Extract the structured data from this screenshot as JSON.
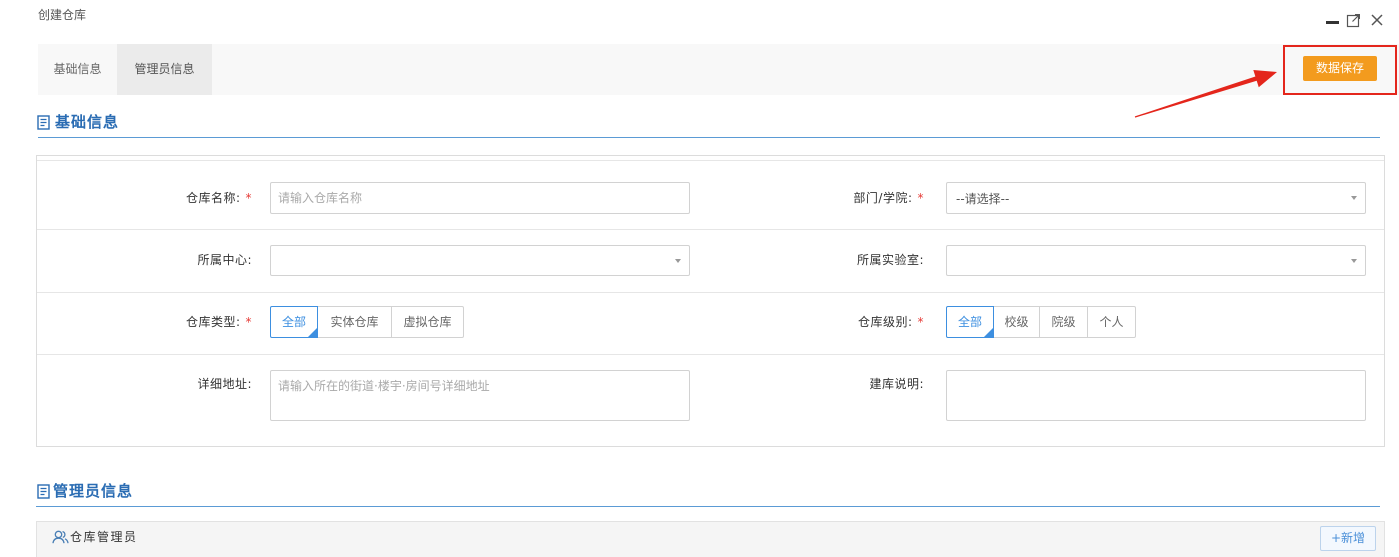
{
  "window": {
    "title": "创建仓库",
    "controls": {
      "minimize": "minimize-icon",
      "maximize": "maximize-icon",
      "close": "close-icon"
    }
  },
  "tabs": [
    {
      "label": "基础信息",
      "active": false
    },
    {
      "label": "管理员信息",
      "active": true
    }
  ],
  "toolbar": {
    "save_label": "数据保存"
  },
  "sections": {
    "basic": {
      "title": "基础信息",
      "icon": "document-icon"
    },
    "admin": {
      "title": "管理员信息",
      "icon": "document-icon"
    }
  },
  "form": {
    "required_mark": "*",
    "select_icon": "caret-down-icon",
    "warehouse_name": {
      "label": "仓库名称:",
      "placeholder": "请输入仓库名称"
    },
    "department": {
      "label": "部门/学院:",
      "selected": "--请选择--"
    },
    "center": {
      "label": "所属中心:",
      "selected": ""
    },
    "lab": {
      "label": "所属实验室:",
      "selected": ""
    },
    "warehouse_type": {
      "label": "仓库类型:",
      "options": [
        {
          "label": "全部",
          "selected": true
        },
        {
          "label": "实体仓库",
          "selected": false
        },
        {
          "label": "虚拟仓库",
          "selected": false
        }
      ]
    },
    "warehouse_level": {
      "label": "仓库级别:",
      "options": [
        {
          "label": "全部",
          "selected": true
        },
        {
          "label": "校级",
          "selected": false
        },
        {
          "label": "院级",
          "selected": false
        },
        {
          "label": "个人",
          "selected": false
        }
      ]
    },
    "address": {
      "label": "详细地址:",
      "placeholder": "请输入所在的街道·楼宇·房间号详细地址"
    },
    "description": {
      "label": "建库说明:"
    }
  },
  "admin_panel": {
    "title": "仓库管理员",
    "icon": "users-icon",
    "add_label": "+新增"
  },
  "colors": {
    "accent": "#2a6cb3",
    "accent_line": "#5b9bd5",
    "save_button": "#f39b1e",
    "annotation": "#e4261c",
    "required": "#e53935",
    "selected_option": "#3d8fe0",
    "add_button_text": "#4a8fd8"
  }
}
